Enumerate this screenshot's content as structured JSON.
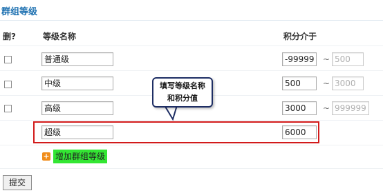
{
  "title": "群组等级",
  "headers": {
    "delete": "删?",
    "name": "等级名称",
    "range": "积分介于",
    "tilde": "~"
  },
  "rows": [
    {
      "name": "普通级",
      "min": "-99999",
      "max": "500"
    },
    {
      "name": "中级",
      "min": "500",
      "max": "3000"
    },
    {
      "name": "高级",
      "min": "3000",
      "max": "999999"
    },
    {
      "name": "超级",
      "min": "6000"
    }
  ],
  "add_label": "增加群组等级",
  "submit_label": "提交",
  "callout": {
    "line1": "填写等级名称",
    "line2": "和积分值"
  },
  "colors": {
    "title": "#1b6fb0",
    "highlight_box": "#d21a1a",
    "add_bg": "#33e633",
    "plus_icon": "#f08c1a"
  }
}
